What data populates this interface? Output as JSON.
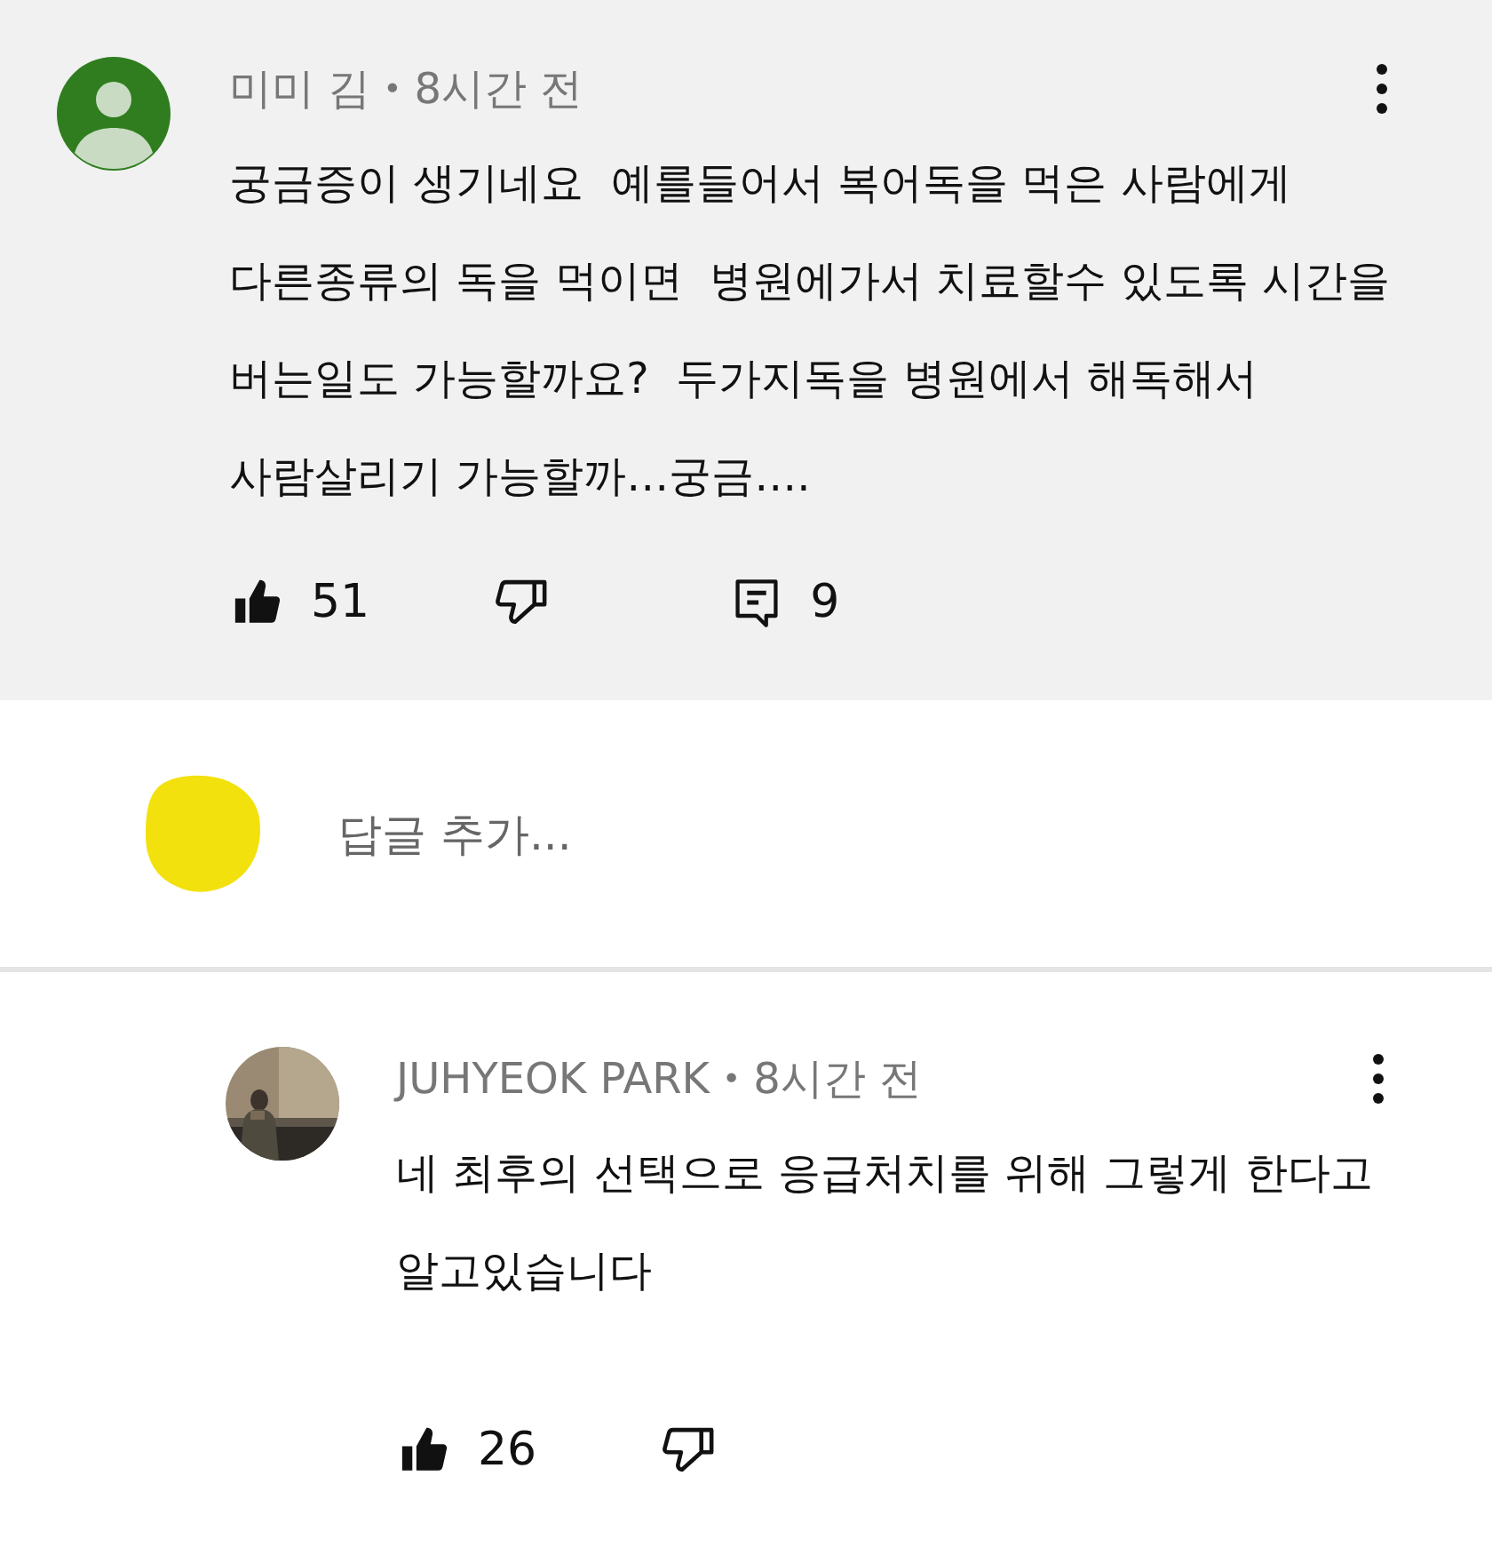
{
  "comments": [
    {
      "author": "미미 김",
      "separator": "•",
      "time": "8시간 전",
      "avatar": {
        "kind": "default"
      },
      "lines": [
        "궁금증이 생기네요  예를들어서 복어독을 먹은 사람에게",
        "다른종류의 독을 먹이면  병원에가서 치료할수 있도록 시간을",
        "버는일도 가능할까요?  두가지독을 병원에서 해독해서",
        "사람살리기 가능할까…궁금…."
      ],
      "likes": "51",
      "liked": true,
      "disliked": false,
      "reply_count": "9"
    }
  ],
  "reply_box": {
    "placeholder": "답글 추가..."
  },
  "replies": [
    {
      "author": "JUHYEOK PARK",
      "separator": "•",
      "time": "8시간 전",
      "lines": [
        "네 최후의 선택으로 응급처치를 위해 그렇게 한다고",
        "알고있습니다"
      ],
      "likes": "26",
      "liked": true,
      "disliked": false
    }
  ]
}
